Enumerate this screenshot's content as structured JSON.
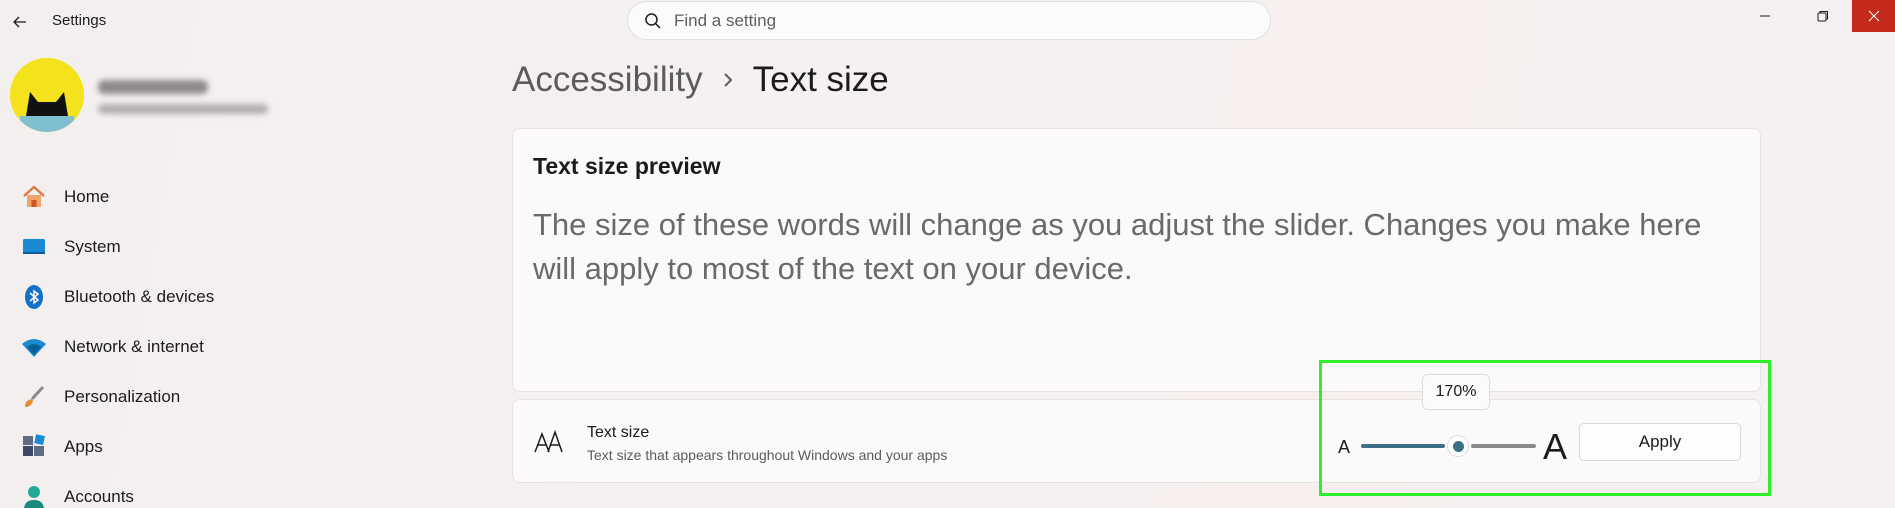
{
  "window": {
    "app_title": "Settings",
    "controls": [
      "minimize-icon",
      "restore-icon",
      "close-icon"
    ],
    "close_color": "#c42b1c"
  },
  "search": {
    "placeholder": "Find a setting",
    "value": ""
  },
  "sidebar": {
    "items": [
      {
        "label": "Home",
        "icon": "home-icon"
      },
      {
        "label": "System",
        "icon": "system-display-icon"
      },
      {
        "label": "Bluetooth & devices",
        "icon": "bluetooth-icon"
      },
      {
        "label": "Network & internet",
        "icon": "wifi-icon"
      },
      {
        "label": "Personalization",
        "icon": "brush-icon"
      },
      {
        "label": "Apps",
        "icon": "apps-icon"
      },
      {
        "label": "Accounts",
        "icon": "person-icon"
      }
    ]
  },
  "breadcrumb": {
    "parent": "Accessibility",
    "current": "Text size"
  },
  "preview": {
    "title": "Text size preview",
    "text": "The size of these words will change as you adjust the slider. Changes you make here will apply to most of the text on your device."
  },
  "text_size": {
    "label": "Text size",
    "description": "Text size that appears throughout Windows and your apps",
    "small_glyph": "A",
    "large_glyph": "A",
    "value_label": "170%",
    "value_percent": 170,
    "apply_label": "Apply",
    "accent_color": "#3c6f86"
  },
  "annotation": {
    "highlight_color": "#2df02a"
  }
}
